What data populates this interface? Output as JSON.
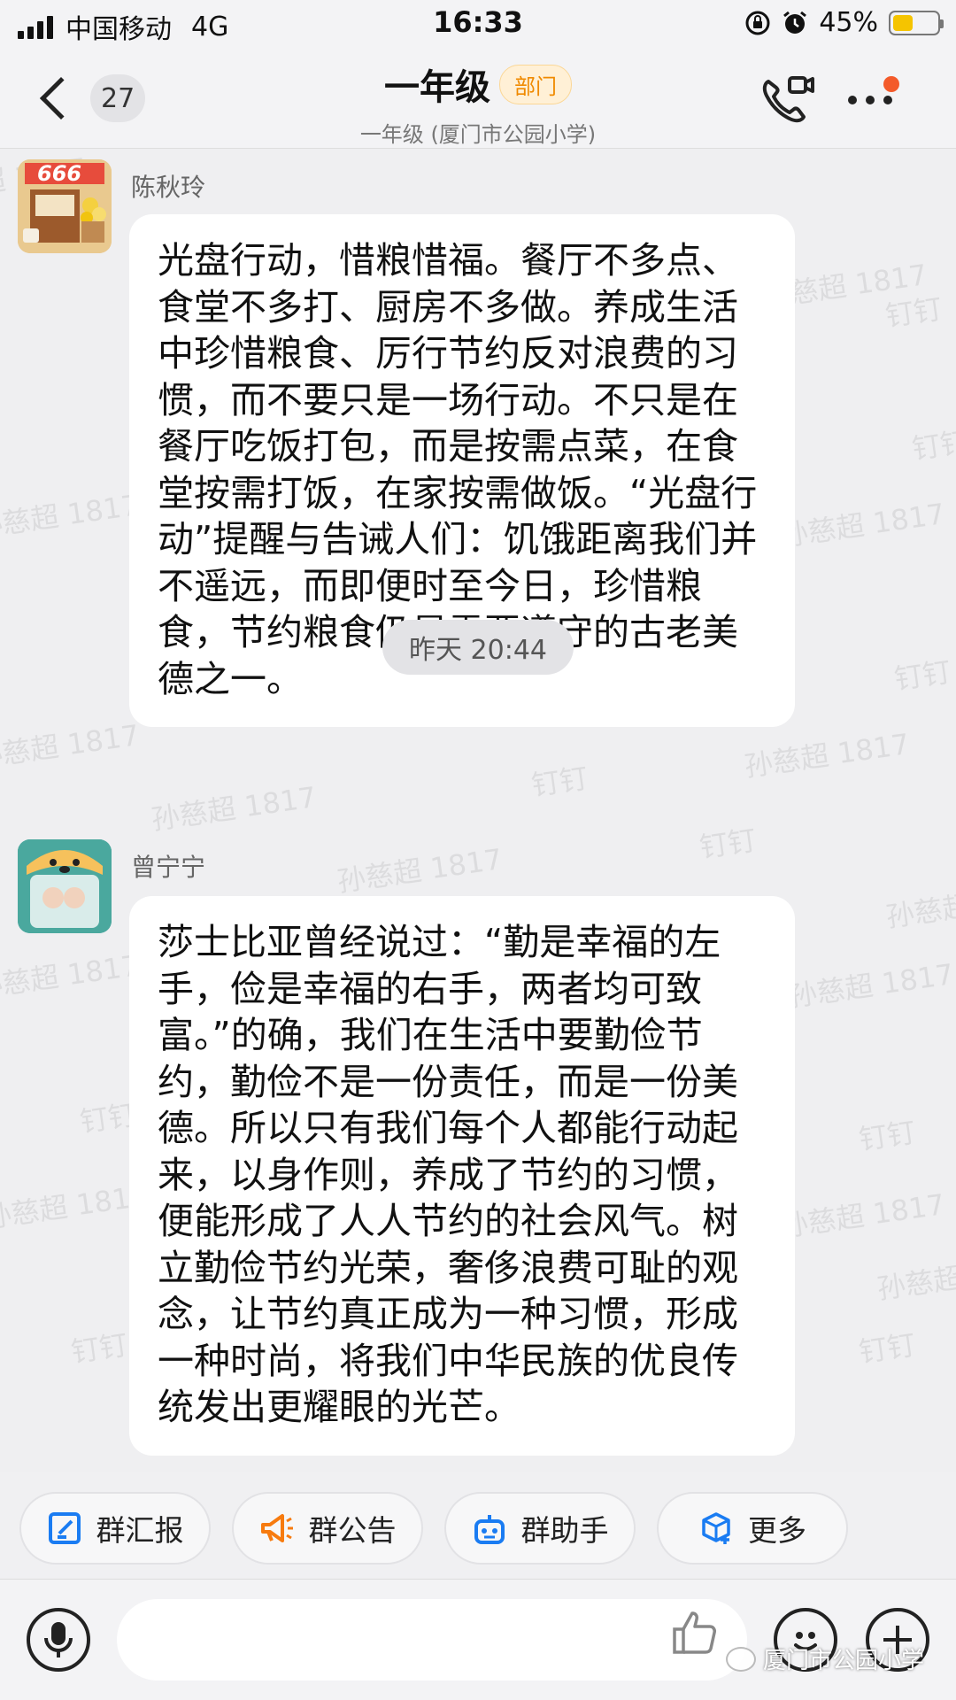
{
  "status_bar": {
    "carrier": "中国移动",
    "network": "4G",
    "time": "16:33",
    "battery_percent": "45%",
    "battery_level": 0.45
  },
  "header": {
    "back_count": "27",
    "title": "一年级",
    "tag": "部门",
    "subtitle": "一年级 (厦门市公园小学)",
    "call_icon": "video-call-icon",
    "more_icon": "more-icon",
    "has_notification_dot": true
  },
  "watermark": {
    "name": "孙慈超 1817",
    "app": "钉钉"
  },
  "messages": [
    {
      "sender": "陈秋玲",
      "avatar_badge": "666",
      "text": "光盘行动，惜粮惜福。餐厅不多点、食堂不多打、厨房不多做。养成生活中珍惜粮食、厉行节约反对浪费的习惯，而不要只是一场行动。不只是在餐厅吃饭打包，而是按需点菜，在食堂按需打饭，在家按需做饭。“光盘行动”提醒与告诫人们：饥饿距离我们并不遥远，而即便时至今日，珍惜粮食，节约粮食仍是需要遵守的古老美德之一。"
    },
    {
      "sender": "曾宁宁",
      "text": "莎士比亚曾经说过：“勤是幸福的左手，俭是幸福的右手，两者均可致富。”的确，我们在生活中要勤俭节约，勤俭不是一份责任，而是一份美德。所以只有我们每个人都能行动起来，以身作则，养成了节约的习惯，便能形成了人人节约的社会风气。树立勤俭节约光荣，奢侈浪费可耻的观念，让节约真正成为一种习惯，形成一种时尚，将我们中华民族的优良传统发出更耀眼的光芒。"
    }
  ],
  "time_separator": "昨天 20:44",
  "quick_actions": [
    {
      "label": "群汇报",
      "icon": "report-icon"
    },
    {
      "label": "群公告",
      "icon": "megaphone-icon"
    },
    {
      "label": "群助手",
      "icon": "robot-icon"
    },
    {
      "label": "更多",
      "icon": "cube-plus-icon"
    }
  ],
  "input": {
    "value": "",
    "placeholder": ""
  },
  "credit": "厦门市公园小学",
  "colors": {
    "accent_orange": "#f08a00",
    "blue_icon": "#1a7cf2",
    "orange_icon": "#f77b0f"
  }
}
